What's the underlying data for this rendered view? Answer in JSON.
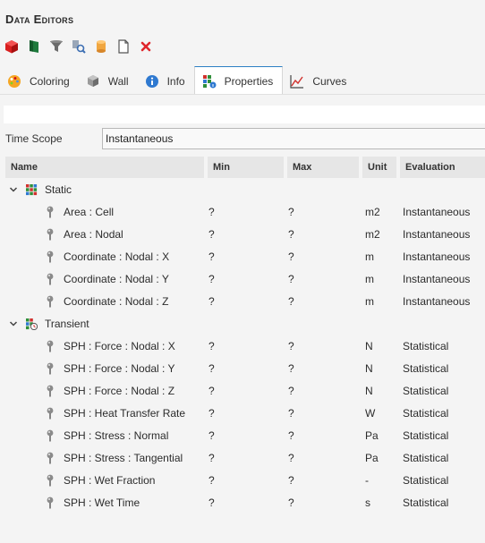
{
  "window": {
    "title": "Data Editors"
  },
  "toolbar": {
    "buttons": [
      {
        "name": "cube-red-icon"
      },
      {
        "name": "flag-green-icon"
      },
      {
        "name": "filter-icon"
      },
      {
        "name": "find-icon"
      },
      {
        "name": "cylinder-icon"
      },
      {
        "name": "copy-icon"
      },
      {
        "name": "delete-icon"
      }
    ]
  },
  "tabs": [
    {
      "label": "Coloring",
      "icon": "palette-icon"
    },
    {
      "label": "Wall",
      "icon": "wall-icon"
    },
    {
      "label": "Info",
      "icon": "info-icon"
    },
    {
      "label": "Properties",
      "icon": "properties-icon",
      "active": true
    },
    {
      "label": "Curves",
      "icon": "curve-icon"
    }
  ],
  "time_scope": {
    "label": "Time Scope",
    "value": "Instantaneous"
  },
  "columns": {
    "name": "Name",
    "min": "Min",
    "max": "Max",
    "unit": "Unit",
    "evaluation": "Evaluation"
  },
  "groups": [
    {
      "label": "Static",
      "rows": [
        {
          "name": "Area : Cell",
          "min": "?",
          "max": "?",
          "unit": "m2",
          "evaluation": "Instantaneous"
        },
        {
          "name": "Area : Nodal",
          "min": "?",
          "max": "?",
          "unit": "m2",
          "evaluation": "Instantaneous"
        },
        {
          "name": "Coordinate : Nodal : X",
          "min": "?",
          "max": "?",
          "unit": "m",
          "evaluation": "Instantaneous"
        },
        {
          "name": "Coordinate : Nodal : Y",
          "min": "?",
          "max": "?",
          "unit": "m",
          "evaluation": "Instantaneous"
        },
        {
          "name": "Coordinate : Nodal : Z",
          "min": "?",
          "max": "?",
          "unit": "m",
          "evaluation": "Instantaneous"
        }
      ]
    },
    {
      "label": "Transient",
      "rows": [
        {
          "name": "SPH : Force : Nodal : X",
          "min": "?",
          "max": "?",
          "unit": "N",
          "evaluation": "Statistical"
        },
        {
          "name": "SPH : Force : Nodal : Y",
          "min": "?",
          "max": "?",
          "unit": "N",
          "evaluation": "Statistical"
        },
        {
          "name": "SPH : Force : Nodal : Z",
          "min": "?",
          "max": "?",
          "unit": "N",
          "evaluation": "Statistical"
        },
        {
          "name": "SPH : Heat Transfer Rate",
          "min": "?",
          "max": "?",
          "unit": "W",
          "evaluation": "Statistical"
        },
        {
          "name": "SPH : Stress : Normal",
          "min": "?",
          "max": "?",
          "unit": "Pa",
          "evaluation": "Statistical"
        },
        {
          "name": "SPH : Stress : Tangential",
          "min": "?",
          "max": "?",
          "unit": "Pa",
          "evaluation": "Statistical"
        },
        {
          "name": "SPH : Wet Fraction",
          "min": "?",
          "max": "?",
          "unit": "-",
          "evaluation": "Statistical"
        },
        {
          "name": "SPH : Wet Time",
          "min": "?",
          "max": "?",
          "unit": "s",
          "evaluation": "Statistical"
        }
      ]
    }
  ]
}
